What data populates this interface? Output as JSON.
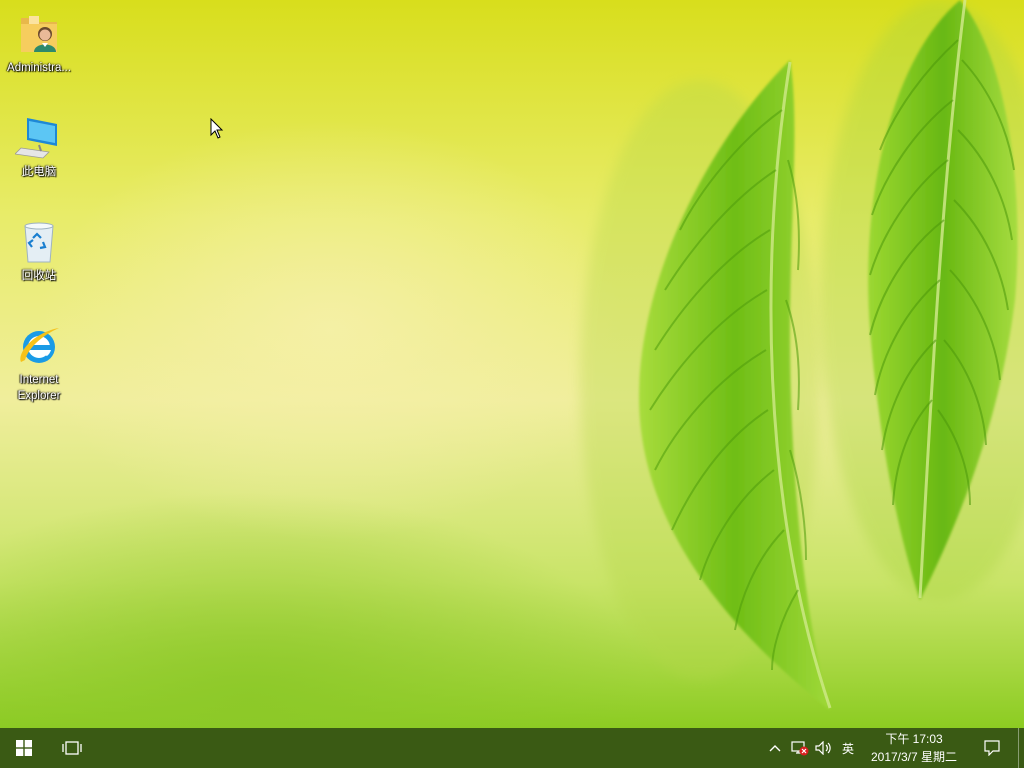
{
  "desktop": {
    "icons": [
      {
        "label": "Administra...",
        "icon": "user-folder-icon"
      },
      {
        "label": "此电脑",
        "icon": "computer-icon"
      },
      {
        "label": "回收站",
        "icon": "recycle-bin-icon"
      },
      {
        "label": "Internet Explorer",
        "label_line1": "Internet",
        "label_line2": "Explorer",
        "icon": "internet-explorer-icon"
      }
    ]
  },
  "taskbar": {
    "start_icon": "windows-start-icon",
    "task_view_icon": "task-view-icon",
    "tray": {
      "show_hidden_icon": "chevron-up-icon",
      "network_icon": "network-disconnected-icon",
      "volume_icon": "volume-icon",
      "input_method": "英"
    },
    "clock": {
      "time": "下午 17:03",
      "date": "2017/3/7 星期二"
    },
    "notification_icon": "action-center-icon"
  },
  "colors": {
    "taskbar": "#3a5a14",
    "wallpaper_top": "#d8de1c",
    "wallpaper_mid": "#f0ee9c",
    "wallpaper_bottom": "#8ccc22",
    "leaf": "#7cc41e"
  }
}
